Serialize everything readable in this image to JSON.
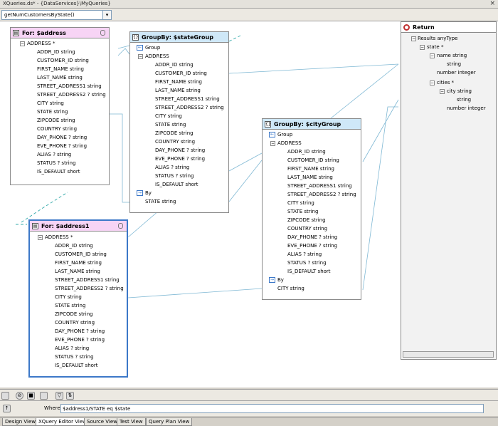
{
  "title": "XQueries.ds* - {DataServices}\\MyQueries}",
  "function_select": {
    "value": "getNumCustomersByState()"
  },
  "for_address": {
    "title": "For: $address",
    "root": "ADDRESS *",
    "fields": [
      "ADDR_ID string",
      "CUSTOMER_ID string",
      "FIRST_NAME string",
      "LAST_NAME string",
      "STREET_ADDRESS1 string",
      "STREET_ADDRESS2 ? string",
      "CITY string",
      "STATE string",
      "ZIPCODE string",
      "COUNTRY string",
      "DAY_PHONE ? string",
      "EVE_PHONE ? string",
      "ALIAS ? string",
      "STATUS ? string",
      "IS_DEFAULT short"
    ]
  },
  "group_state": {
    "title": "GroupBy: $stateGroup",
    "group_label": "Group",
    "root": "ADDRESS",
    "fields": [
      "ADDR_ID string",
      "CUSTOMER_ID string",
      "FIRST_NAME string",
      "LAST_NAME string",
      "STREET_ADDRESS1 string",
      "STREET_ADDRESS2 ? string",
      "CITY string",
      "STATE string",
      "ZIPCODE string",
      "COUNTRY string",
      "DAY_PHONE ? string",
      "EVE_PHONE ? string",
      "ALIAS ? string",
      "STATUS ? string",
      "IS_DEFAULT short"
    ],
    "by_label": "By",
    "by_field": "STATE string"
  },
  "for_address1": {
    "title": "For: $address1",
    "root": "ADDRESS *",
    "fields": [
      "ADDR_ID string",
      "CUSTOMER_ID string",
      "FIRST_NAME string",
      "LAST_NAME string",
      "STREET_ADDRESS1 string",
      "STREET_ADDRESS2 ? string",
      "CITY string",
      "STATE string",
      "ZIPCODE string",
      "COUNTRY string",
      "DAY_PHONE ? string",
      "EVE_PHONE ? string",
      "ALIAS ? string",
      "STATUS ? string",
      "IS_DEFAULT short"
    ]
  },
  "group_city": {
    "title": "GroupBy: $cityGroup",
    "group_label": "Group",
    "root": "ADDRESS",
    "fields": [
      "ADDR_ID string",
      "CUSTOMER_ID string",
      "FIRST_NAME string",
      "LAST_NAME string",
      "STREET_ADDRESS1 string",
      "STREET_ADDRESS2 ? string",
      "CITY string",
      "STATE string",
      "ZIPCODE string",
      "COUNTRY string",
      "DAY_PHONE ? string",
      "EVE_PHONE ? string",
      "ALIAS ? string",
      "STATUS ? string",
      "IS_DEFAULT short"
    ],
    "by_label": "By",
    "by_field": "CITY string"
  },
  "return_panel": {
    "title": "Return",
    "tree": [
      "Results anyType",
      "state *",
      "name string",
      "string",
      "number integer",
      "cities *",
      "city string",
      "string",
      "number integer"
    ]
  },
  "where": {
    "label": "Where",
    "value": "$address1/STATE eq $state"
  },
  "tabs": [
    "Design View",
    "XQuery Editor View",
    "Source View",
    "Test View",
    "Query Plan View"
  ],
  "active_tab": "XQuery Editor View",
  "colors": {
    "for_header": "#f7d4f5",
    "group_header": "#cfe8f8",
    "link": "#7fb8d4",
    "selection": "#3c78c8",
    "return_icon": "#c03030"
  }
}
